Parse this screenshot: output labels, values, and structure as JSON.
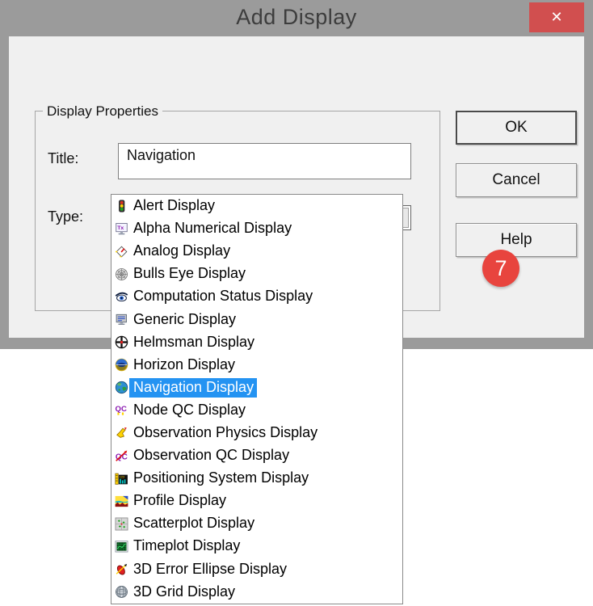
{
  "window": {
    "title": "Add Display",
    "close_glyph": "✕"
  },
  "display_properties": {
    "group_label": "Display Properties",
    "title_label": "Title:",
    "title_value": "Navigation",
    "type_label": "Type:",
    "type_selected": {
      "label": "Navigation Display",
      "icon": "navigation"
    }
  },
  "type_options": [
    {
      "label": "Alert Display",
      "icon": "alert",
      "selected": false
    },
    {
      "label": "Alpha Numerical Display",
      "icon": "alpha-numerical",
      "selected": false
    },
    {
      "label": "Analog Display",
      "icon": "analog",
      "selected": false
    },
    {
      "label": "Bulls Eye Display",
      "icon": "bulls-eye",
      "selected": false
    },
    {
      "label": "Computation Status Display",
      "icon": "computation-status",
      "selected": false
    },
    {
      "label": "Generic Display",
      "icon": "generic",
      "selected": false
    },
    {
      "label": "Helmsman Display",
      "icon": "helmsman",
      "selected": false
    },
    {
      "label": "Horizon Display",
      "icon": "horizon",
      "selected": false
    },
    {
      "label": "Navigation Display",
      "icon": "navigation",
      "selected": true
    },
    {
      "label": "Node QC Display",
      "icon": "node-qc",
      "selected": false
    },
    {
      "label": "Observation Physics Display",
      "icon": "observation-physics",
      "selected": false
    },
    {
      "label": "Observation QC Display",
      "icon": "observation-qc",
      "selected": false
    },
    {
      "label": "Positioning System Display",
      "icon": "positioning-system",
      "selected": false
    },
    {
      "label": "Profile Display",
      "icon": "profile",
      "selected": false
    },
    {
      "label": "Scatterplot Display",
      "icon": "scatterplot",
      "selected": false
    },
    {
      "label": "Timeplot Display",
      "icon": "timeplot",
      "selected": false
    },
    {
      "label": "3D Error Ellipse Display",
      "icon": "error-ellipse-3d",
      "selected": false
    },
    {
      "label": "3D Grid Display",
      "icon": "grid-3d",
      "selected": false
    }
  ],
  "buttons": {
    "ok": "OK",
    "cancel": "Cancel",
    "help": "Help"
  },
  "annotation": {
    "step": "7"
  },
  "colors": {
    "frame": "#9b9b9b",
    "client": "#f0f0f0",
    "selection": "#2493f2",
    "close_button": "#d14f4f",
    "badge": "#e8443e"
  }
}
